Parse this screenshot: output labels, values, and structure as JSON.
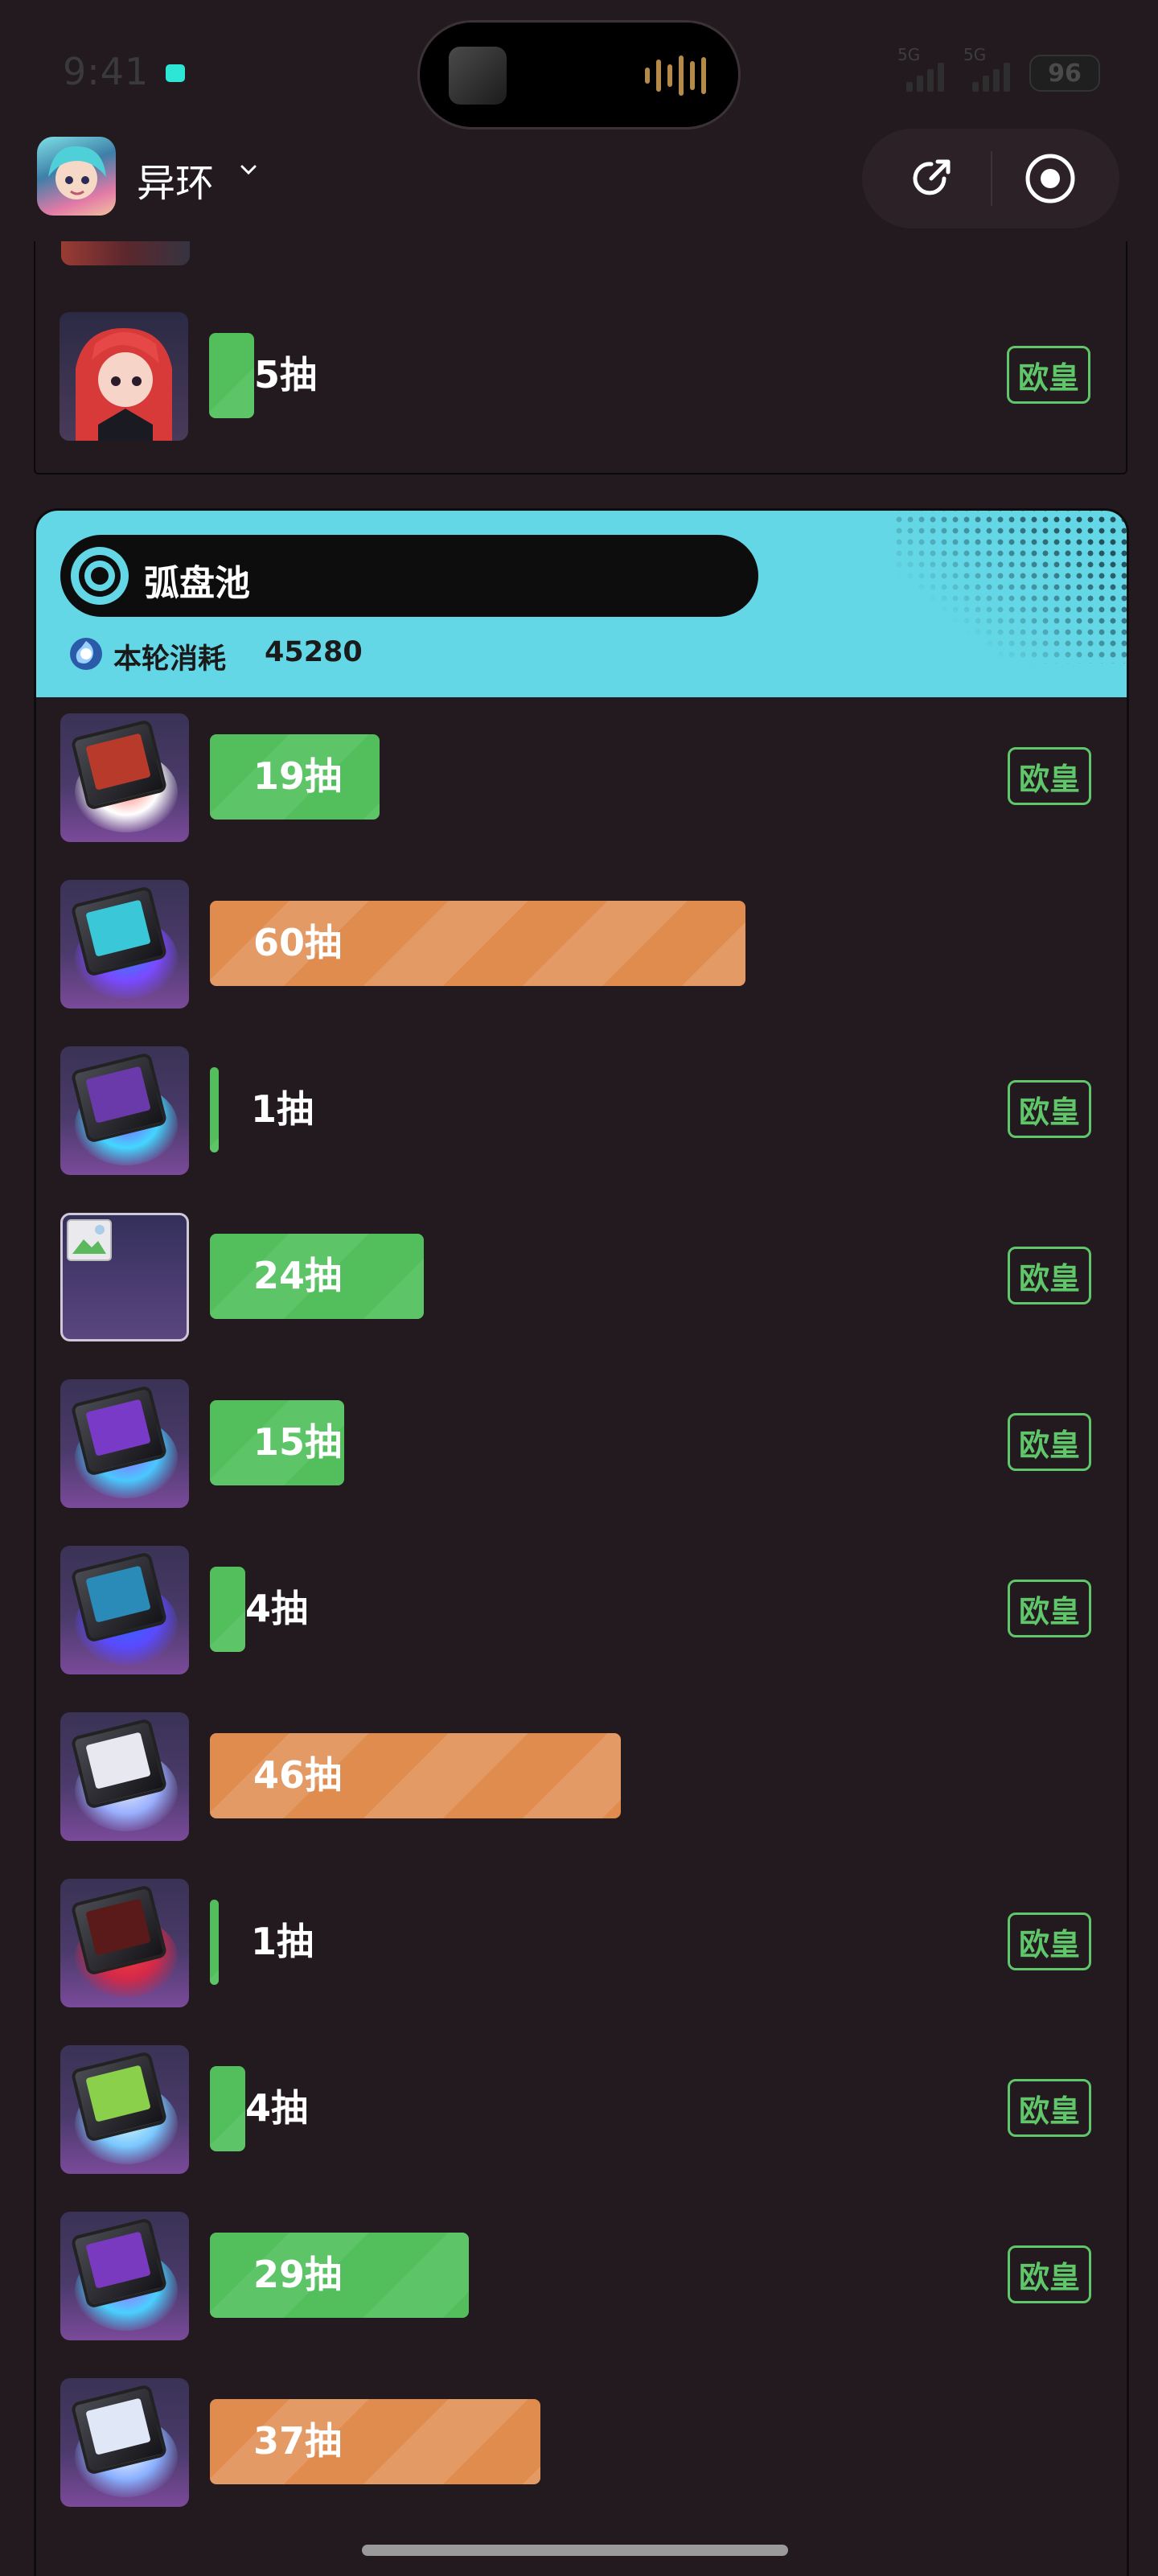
{
  "status": {
    "time": "9:41",
    "signal_1": "5G",
    "signal_2": "5G",
    "battery": "96"
  },
  "header": {
    "app_name": "异环"
  },
  "top_card": {
    "rows": [
      {
        "label": "5抽",
        "badge": "欧皇",
        "fill": 0.05,
        "color": "green"
      }
    ]
  },
  "pool": {
    "name": "弧盘池",
    "spend_label": "本轮消耗",
    "spend_value": "45280",
    "rows": [
      {
        "label": "19抽",
        "fill": 0.19,
        "color": "green",
        "badge": "欧皇"
      },
      {
        "label": "60抽",
        "fill": 0.6,
        "color": "orange",
        "badge": ""
      },
      {
        "label": "1抽",
        "fill": 0.01,
        "color": "green",
        "badge": "欧皇"
      },
      {
        "label": "24抽",
        "fill": 0.24,
        "color": "green",
        "badge": "欧皇"
      },
      {
        "label": "15抽",
        "fill": 0.15,
        "color": "green",
        "badge": "欧皇"
      },
      {
        "label": "4抽",
        "fill": 0.04,
        "color": "green",
        "badge": "欧皇"
      },
      {
        "label": "46抽",
        "fill": 0.46,
        "color": "orange",
        "badge": ""
      },
      {
        "label": "1抽",
        "fill": 0.01,
        "color": "green",
        "badge": "欧皇"
      },
      {
        "label": "4抽",
        "fill": 0.04,
        "color": "green",
        "badge": "欧皇"
      },
      {
        "label": "29抽",
        "fill": 0.29,
        "color": "green",
        "badge": "欧皇"
      },
      {
        "label": "37抽",
        "fill": 0.37,
        "color": "orange",
        "badge": ""
      }
    ]
  },
  "colors": {
    "background": "#231a1f",
    "green": "#52bf5c",
    "orange": "#e08c4f",
    "pool_header": "#63d7e6",
    "badge": "#5fc66a"
  },
  "icons": [
    "share-icon",
    "target-icon",
    "chevron-down-icon",
    "pool-target-icon",
    "currency-icon"
  ]
}
